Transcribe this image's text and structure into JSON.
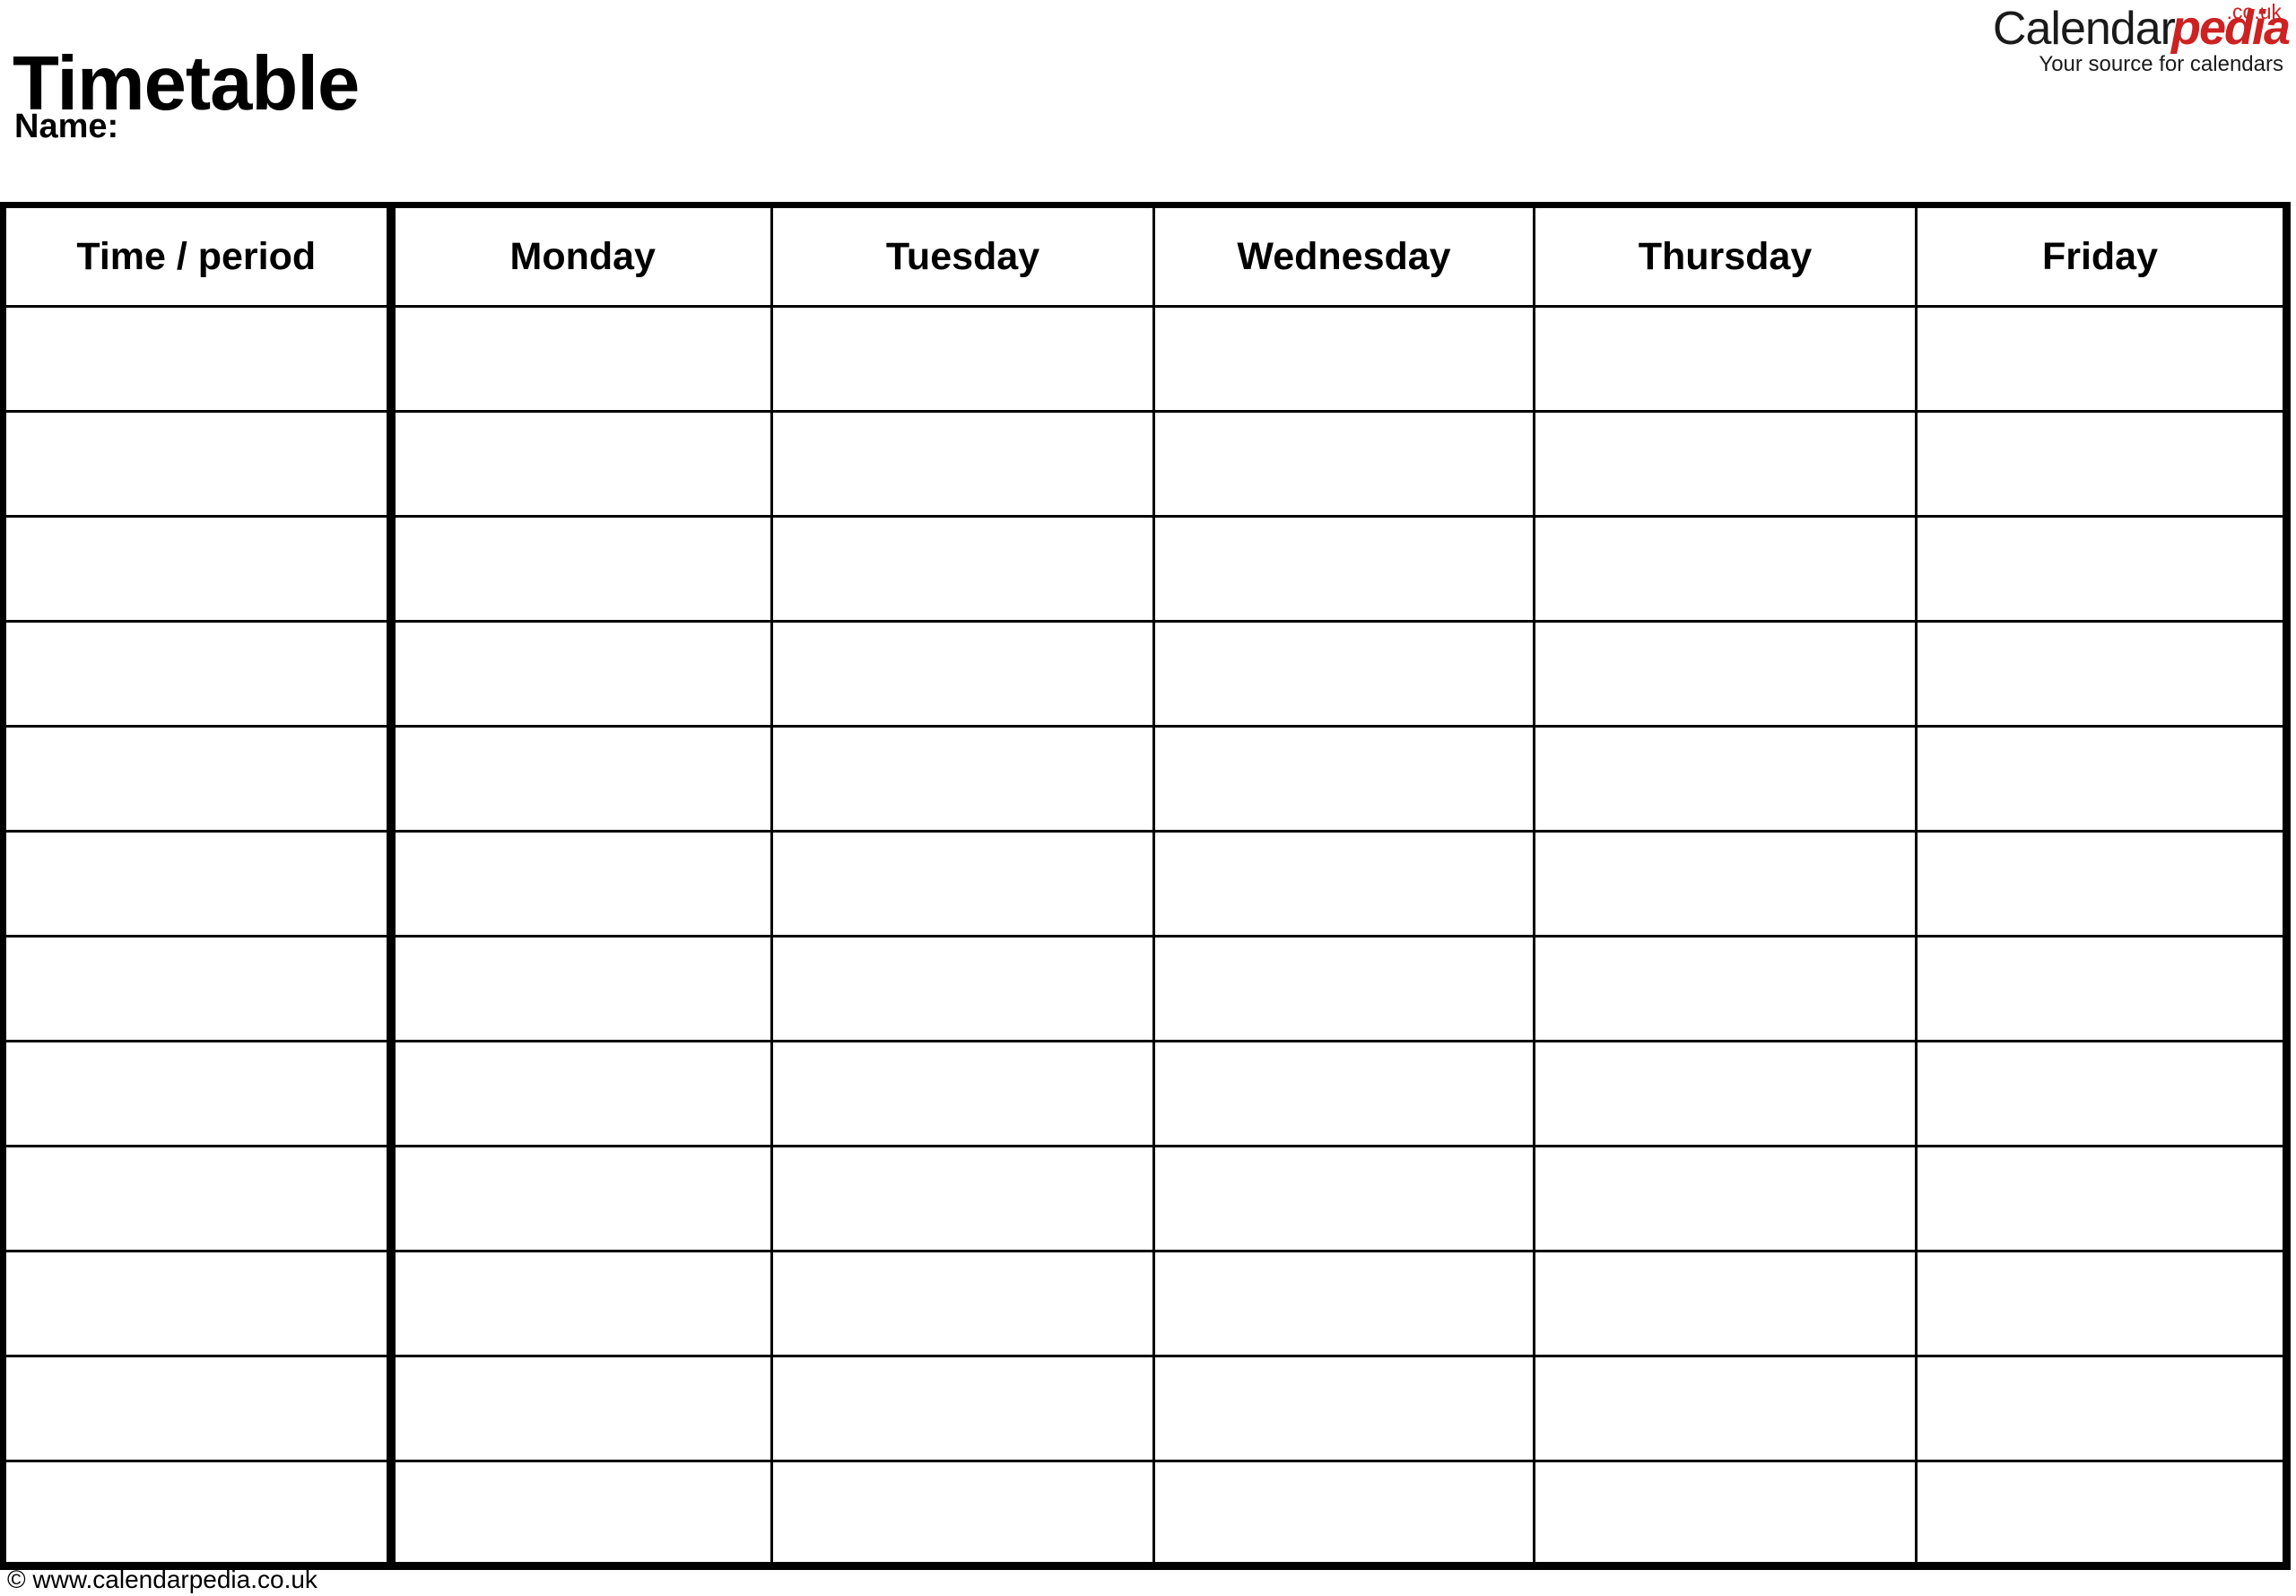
{
  "document": {
    "title": "Timetable",
    "name_label": "Name:"
  },
  "brand": {
    "name_part1": "Calendar",
    "name_part2": "pedia",
    "tld": ".co.uk",
    "tagline": "Your source for calendars",
    "color_black": "#1a1a1a",
    "color_red": "#cc2222"
  },
  "table": {
    "columns": [
      {
        "key": "time",
        "label": "Time / period",
        "header_color": "#ffffff"
      },
      {
        "key": "monday",
        "label": "Monday",
        "header_color": "#9CCDFC"
      },
      {
        "key": "tuesday",
        "label": "Tuesday",
        "header_color": "#8CC800"
      },
      {
        "key": "wednesday",
        "label": "Wednesday",
        "header_color": "#FFC400"
      },
      {
        "key": "thursday",
        "label": "Thursday",
        "header_color": "#FC7B7B"
      },
      {
        "key": "friday",
        "label": "Friday",
        "header_color": "#C490FC"
      }
    ],
    "row_count": 12,
    "rows": [
      {
        "time": "",
        "monday": "",
        "tuesday": "",
        "wednesday": "",
        "thursday": "",
        "friday": ""
      },
      {
        "time": "",
        "monday": "",
        "tuesday": "",
        "wednesday": "",
        "thursday": "",
        "friday": ""
      },
      {
        "time": "",
        "monday": "",
        "tuesday": "",
        "wednesday": "",
        "thursday": "",
        "friday": ""
      },
      {
        "time": "",
        "monday": "",
        "tuesday": "",
        "wednesday": "",
        "thursday": "",
        "friday": ""
      },
      {
        "time": "",
        "monday": "",
        "tuesday": "",
        "wednesday": "",
        "thursday": "",
        "friday": ""
      },
      {
        "time": "",
        "monday": "",
        "tuesday": "",
        "wednesday": "",
        "thursday": "",
        "friday": ""
      },
      {
        "time": "",
        "monday": "",
        "tuesday": "",
        "wednesday": "",
        "thursday": "",
        "friday": ""
      },
      {
        "time": "",
        "monday": "",
        "tuesday": "",
        "wednesday": "",
        "thursday": "",
        "friday": ""
      },
      {
        "time": "",
        "monday": "",
        "tuesday": "",
        "wednesday": "",
        "thursday": "",
        "friday": ""
      },
      {
        "time": "",
        "monday": "",
        "tuesday": "",
        "wednesday": "",
        "thursday": "",
        "friday": ""
      },
      {
        "time": "",
        "monday": "",
        "tuesday": "",
        "wednesday": "",
        "thursday": "",
        "friday": ""
      },
      {
        "time": "",
        "monday": "",
        "tuesday": "",
        "wednesday": "",
        "thursday": "",
        "friday": ""
      }
    ]
  },
  "footer": {
    "copyright": "© www.calendarpedia.co.uk"
  }
}
